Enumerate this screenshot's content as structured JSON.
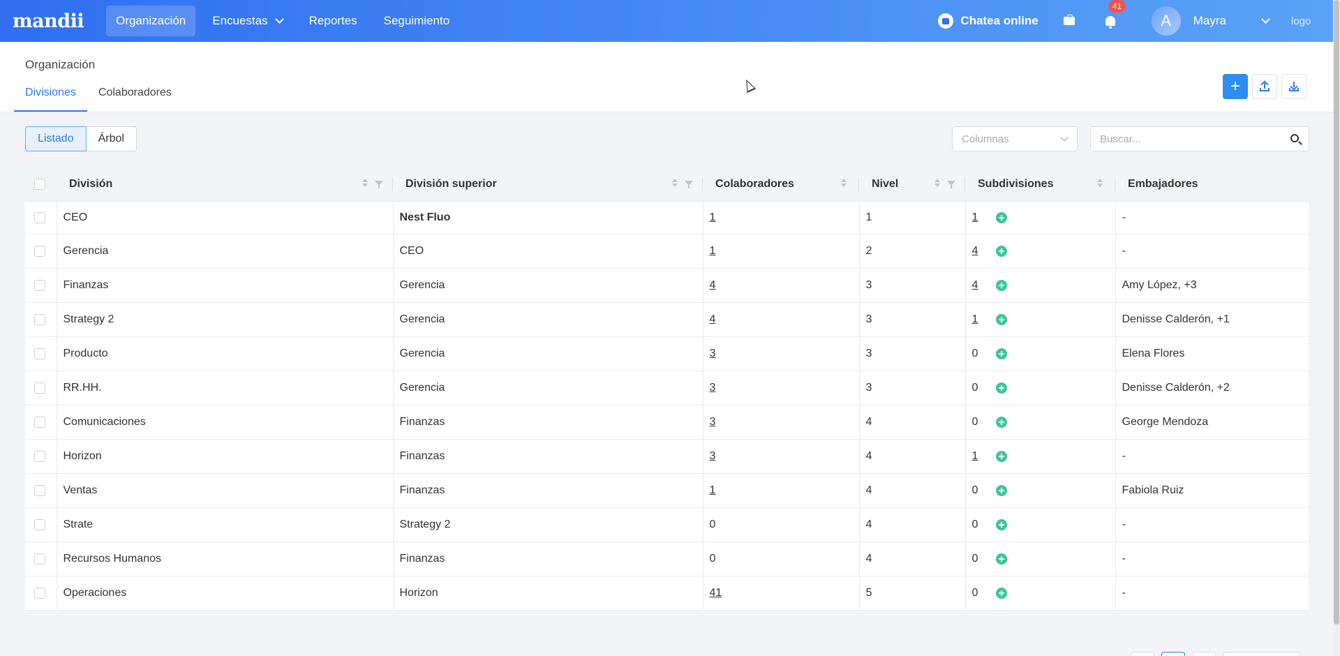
{
  "nav": {
    "brand": "mandii",
    "items": [
      {
        "label": "Organización",
        "active": true
      },
      {
        "label": "Encuestas",
        "dropdown": true
      },
      {
        "label": "Reportes"
      },
      {
        "label": "Seguimiento"
      }
    ],
    "chat_label": "Chatea online",
    "notifications_count": "41",
    "avatar_letter": "A",
    "user_name": "Mayra",
    "logo_alt": "logo"
  },
  "header": {
    "title": "Organización",
    "tabs": [
      "Divisiones",
      "Colaboradores"
    ],
    "active_tab": "Divisiones"
  },
  "toolbar": {
    "views": [
      "Listado",
      "Árbol"
    ],
    "active_view": "Listado",
    "columns_placeholder": "Columnas",
    "search_placeholder": "Buscar..."
  },
  "table": {
    "headers": [
      "División",
      "División superior",
      "Colaboradores",
      "Nivel",
      "Subdivisiones",
      "Embajadores"
    ],
    "rows": [
      {
        "division": "CEO",
        "superior": "Nest Fluo",
        "superior_bold": true,
        "colaboradores": "1",
        "colab_link": true,
        "nivel": "1",
        "subdivisiones": "1",
        "sub_link": true,
        "embajadores": "-"
      },
      {
        "division": "Gerencia",
        "superior": "CEO",
        "colaboradores": "1",
        "colab_link": true,
        "nivel": "2",
        "subdivisiones": "4",
        "sub_link": true,
        "embajadores": "-"
      },
      {
        "division": "Finanzas",
        "superior": "Gerencia",
        "colaboradores": "4",
        "colab_link": true,
        "nivel": "3",
        "subdivisiones": "4",
        "sub_link": true,
        "embajadores": "Amy López, +3"
      },
      {
        "division": "Strategy 2",
        "superior": "Gerencia",
        "colaboradores": "4",
        "colab_link": true,
        "nivel": "3",
        "subdivisiones": "1",
        "sub_link": true,
        "embajadores": "Denisse Calderón, +1"
      },
      {
        "division": "Producto",
        "superior": "Gerencia",
        "colaboradores": "3",
        "colab_link": true,
        "nivel": "3",
        "subdivisiones": "0",
        "sub_link": false,
        "embajadores": "Elena Flores"
      },
      {
        "division": "RR.HH.",
        "superior": "Gerencia",
        "colaboradores": "3",
        "colab_link": true,
        "nivel": "3",
        "subdivisiones": "0",
        "sub_link": false,
        "embajadores": "Denisse Calderón, +2"
      },
      {
        "division": "Comunicaciones",
        "superior": "Finanzas",
        "colaboradores": "3",
        "colab_link": true,
        "nivel": "4",
        "subdivisiones": "0",
        "sub_link": false,
        "embajadores": "George Mendoza"
      },
      {
        "division": "Horizon",
        "superior": "Finanzas",
        "colaboradores": "3",
        "colab_link": true,
        "nivel": "4",
        "subdivisiones": "1",
        "sub_link": true,
        "embajadores": "-"
      },
      {
        "division": "Ventas",
        "superior": "Finanzas",
        "colaboradores": "1",
        "colab_link": true,
        "nivel": "4",
        "subdivisiones": "0",
        "sub_link": false,
        "embajadores": "Fabiola Ruiz"
      },
      {
        "division": "Strate",
        "superior": "Strategy 2",
        "colaboradores": "0",
        "colab_link": false,
        "nivel": "4",
        "subdivisiones": "0",
        "sub_link": false,
        "embajadores": "-"
      },
      {
        "division": "Recursos Humanos",
        "superior": "Finanzas",
        "colaboradores": "0",
        "colab_link": false,
        "nivel": "4",
        "subdivisiones": "0",
        "sub_link": false,
        "embajadores": "-"
      },
      {
        "division": "Operaciones",
        "superior": "Horizon",
        "colaboradores": "41",
        "colab_link": true,
        "nivel": "5",
        "subdivisiones": "0",
        "sub_link": false,
        "embajadores": "-"
      }
    ]
  },
  "colors": {
    "nav_start": "#2f6ff0",
    "nav_end": "#5aa2f7",
    "accent": "#2d7be6",
    "badge": "#f4534b",
    "add_green": "#3dc49a"
  },
  "icons": [
    "chat-icon",
    "briefcase-icon",
    "bell-icon",
    "chevron-down-icon",
    "plus-icon",
    "upload-icon",
    "download-icon",
    "search-icon",
    "sort-icon",
    "filter-icon",
    "add-subdivision-icon"
  ]
}
